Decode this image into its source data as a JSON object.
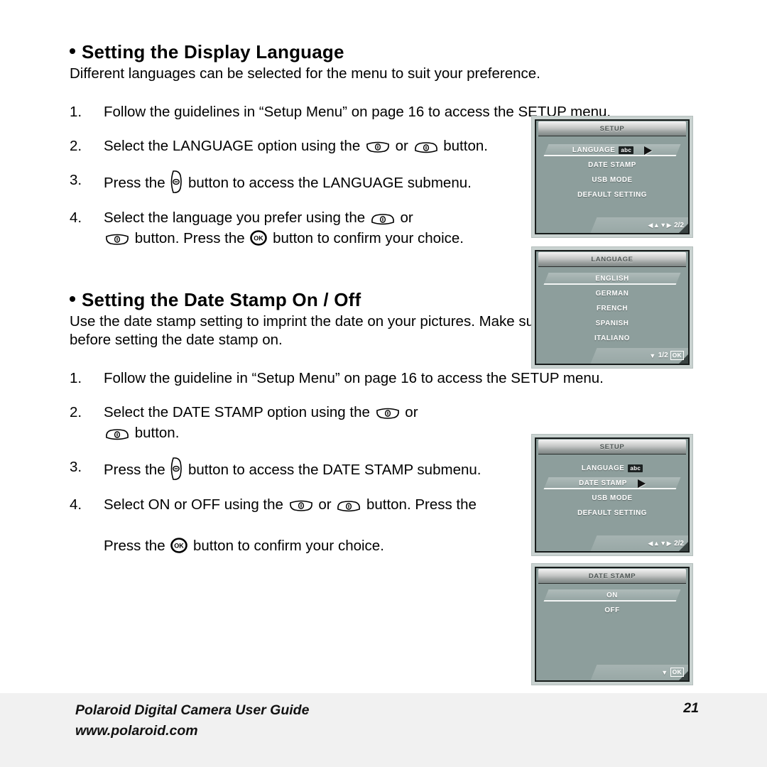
{
  "document": {
    "footer": {
      "guide_title": "Polaroid Digital Camera User Guide",
      "website": "www.polaroid.com",
      "page_number": "21"
    }
  },
  "sections": [
    {
      "heading": "Setting the Display Language",
      "intro": "Different languages can be selected for the menu to suit your preference.",
      "steps": [
        {
          "num": "1.",
          "part1": "Follow the guidelines in “Setup Menu” on page 16 to access the SETUP menu."
        },
        {
          "num": "2.",
          "part1": "Select the LANGUAGE option using the ",
          "part2": " or ",
          "part3": " button."
        },
        {
          "num": "3.",
          "part1": "Press the ",
          "part2": " button to access the LANGUAGE submenu."
        },
        {
          "num": "4.",
          "part1": "Select the language you prefer using the ",
          "part2": " or ",
          "part3": " button. Press the ",
          "part4": " button to confirm your choice."
        }
      ]
    },
    {
      "heading": "Setting the Date Stamp On / Off",
      "intro": "Use the date stamp setting to imprint the date on your pictures. Make sure the date is correct before setting the date stamp on.",
      "steps": [
        {
          "num": "1.",
          "part1": "Follow the guideline in “Setup Menu” on page 16 to access the SETUP menu."
        },
        {
          "num": "2.",
          "part1": "Select the DATE STAMP option using the ",
          "part2": " or ",
          "part3": " button."
        },
        {
          "num": "3.",
          "part1": "Press the ",
          "part2": " button to access the DATE STAMP submenu."
        },
        {
          "num": "4.",
          "part1": "Select ON or OFF using the ",
          "part2": " or ",
          "part3": " button. Press the ",
          "part4": " button to confirm your choice."
        }
      ]
    }
  ],
  "screens": [
    {
      "name": "setup-language",
      "title": "SETUP",
      "items": [
        {
          "label": "LANGUAGE",
          "selected": true,
          "badge": "abc",
          "arrow": true
        },
        {
          "label": "DATE STAMP",
          "selected": false
        },
        {
          "label": "USB MODE",
          "selected": false
        },
        {
          "label": "DEFAULT SETTING",
          "selected": false
        }
      ],
      "footer": {
        "navarrows": "◀▲▼▶",
        "pager": "2/2",
        "ok": ""
      }
    },
    {
      "name": "language-submenu",
      "title": "LANGUAGE",
      "items": [
        {
          "label": "ENGLISH",
          "selected": true
        },
        {
          "label": "GERMAN",
          "selected": false
        },
        {
          "label": "FRENCH",
          "selected": false
        },
        {
          "label": "SPANISH",
          "selected": false
        },
        {
          "label": "ITALIANO",
          "selected": false
        }
      ],
      "footer": {
        "navarrows": "▼",
        "pager": "1/2",
        "ok": "OK"
      }
    },
    {
      "name": "setup-date-stamp",
      "title": "SETUP",
      "items": [
        {
          "label": "LANGUAGE",
          "selected": false,
          "badge": "abc"
        },
        {
          "label": "DATE STAMP",
          "selected": true,
          "arrow": true
        },
        {
          "label": "USB MODE",
          "selected": false
        },
        {
          "label": "DEFAULT SETTING",
          "selected": false
        }
      ],
      "footer": {
        "navarrows": "◀▲▼▶",
        "pager": "2/2",
        "ok": ""
      }
    },
    {
      "name": "date-stamp-submenu",
      "title": "DATE STAMP",
      "items": [
        {
          "label": "ON",
          "selected": true
        },
        {
          "label": "OFF",
          "selected": false
        }
      ],
      "footer": {
        "navarrows": "▼",
        "pager": "",
        "ok": "OK"
      }
    }
  ],
  "colors": {
    "lcd_body": "#8d9e9c",
    "lcd_bezel": "#c9d2d0",
    "footer_band": "#f1f1f1",
    "text": "#000000"
  }
}
